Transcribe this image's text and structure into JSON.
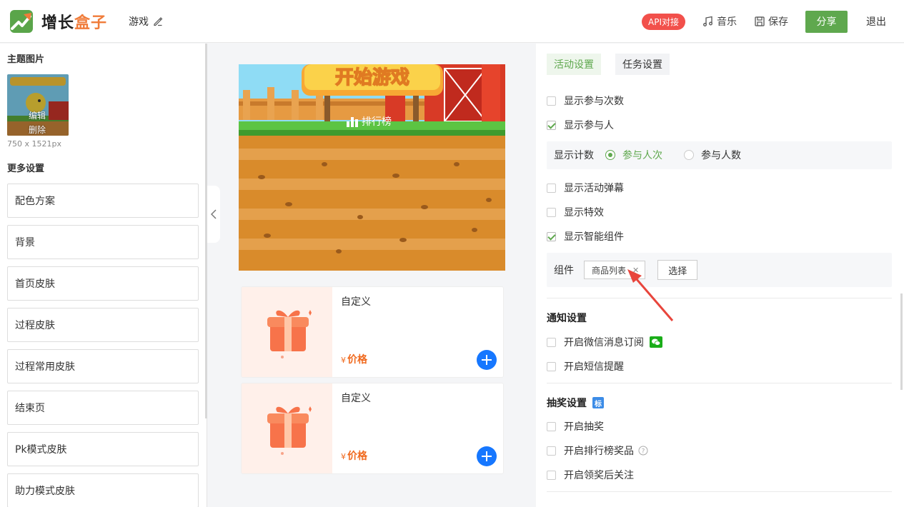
{
  "header": {
    "logo_part1": "增长",
    "logo_part2": "盒子",
    "page_name": "游戏",
    "api_badge": "API对接",
    "music": "音乐",
    "save": "保存",
    "share": "分享",
    "exit": "退出"
  },
  "left": {
    "theme_title": "主题图片",
    "thumb_edit": "编辑",
    "thumb_delete": "删除",
    "thumb_size": "750 x 1521px",
    "more_title": "更多设置",
    "items": [
      "配色方案",
      "背景",
      "首页皮肤",
      "过程皮肤",
      "过程常用皮肤",
      "结束页",
      "Pk模式皮肤",
      "助力模式皮肤"
    ]
  },
  "preview": {
    "rank": "排行榜",
    "products": [
      {
        "name": "自定义",
        "currency": "¥",
        "price": "价格"
      },
      {
        "name": "自定义",
        "currency": "¥",
        "price": "价格"
      }
    ]
  },
  "right": {
    "tabs": [
      "活动设置",
      "任务设置"
    ],
    "show_count": "显示参与次数",
    "show_people": "显示参与人",
    "count_label": "显示计数",
    "count_opt1": "参与人次",
    "count_opt2": "参与人数",
    "show_danmu": "显示活动弹幕",
    "show_effect": "显示特效",
    "show_smart": "显示智能组件",
    "component_label": "组件",
    "component_tag": "商品列表",
    "select": "选择",
    "notify_title": "通知设置",
    "wechat_sub": "开启微信消息订阅",
    "sms": "开启短信提醒",
    "lottery_title": "抽奖设置",
    "lottery_badge": "标",
    "open_lottery": "开启抽奖",
    "rank_prize": "开启排行榜奖品",
    "follow": "开启领奖后关注"
  }
}
